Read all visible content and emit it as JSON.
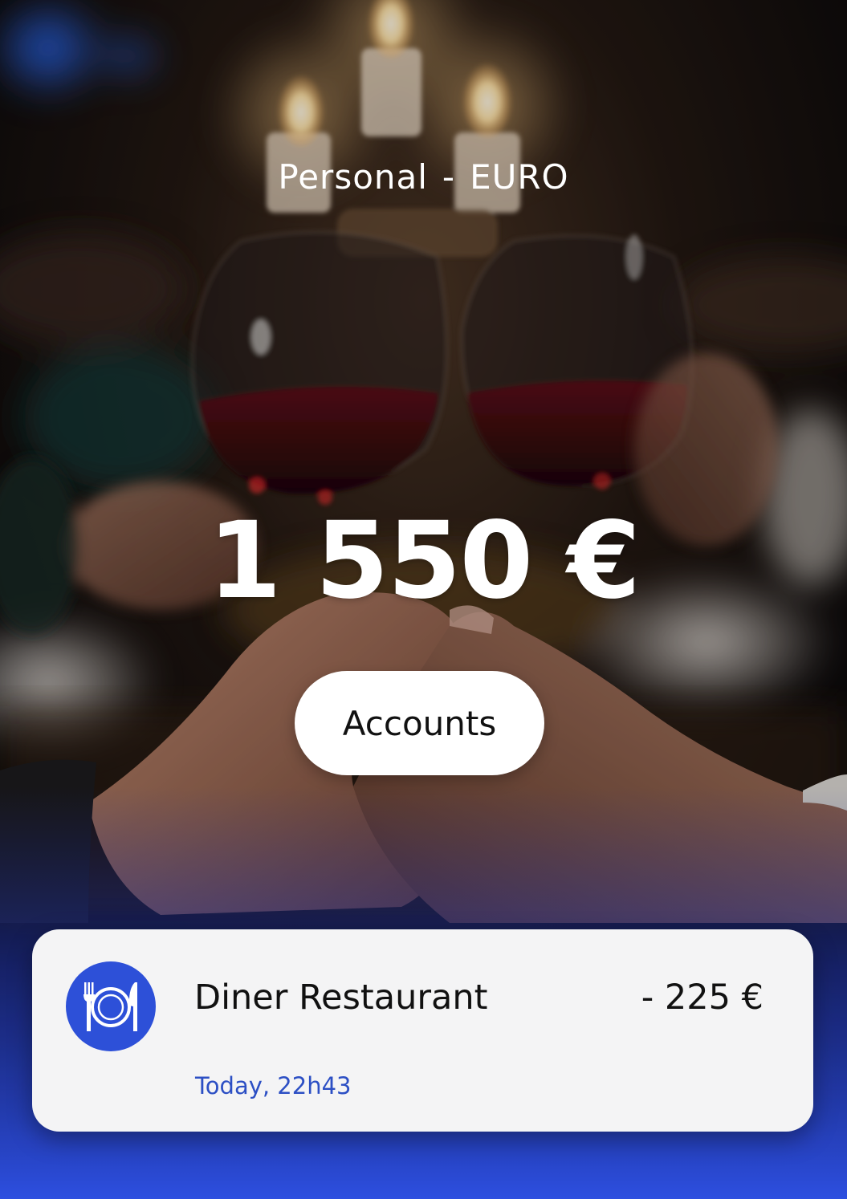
{
  "header": {
    "account_name": "Personal",
    "separator": "-",
    "currency": "EURO"
  },
  "balance": {
    "amount": "1 550 €"
  },
  "actions": {
    "accounts_label": "Accounts"
  },
  "transaction": {
    "icon": "restaurant-icon",
    "name": "Diner Restaurant",
    "amount": "- 225 €",
    "time": "Today, 22h43"
  },
  "colors": {
    "accent_blue": "#2d50d8",
    "time_blue": "#2c4fc4",
    "card_bg": "#f4f4f5"
  }
}
